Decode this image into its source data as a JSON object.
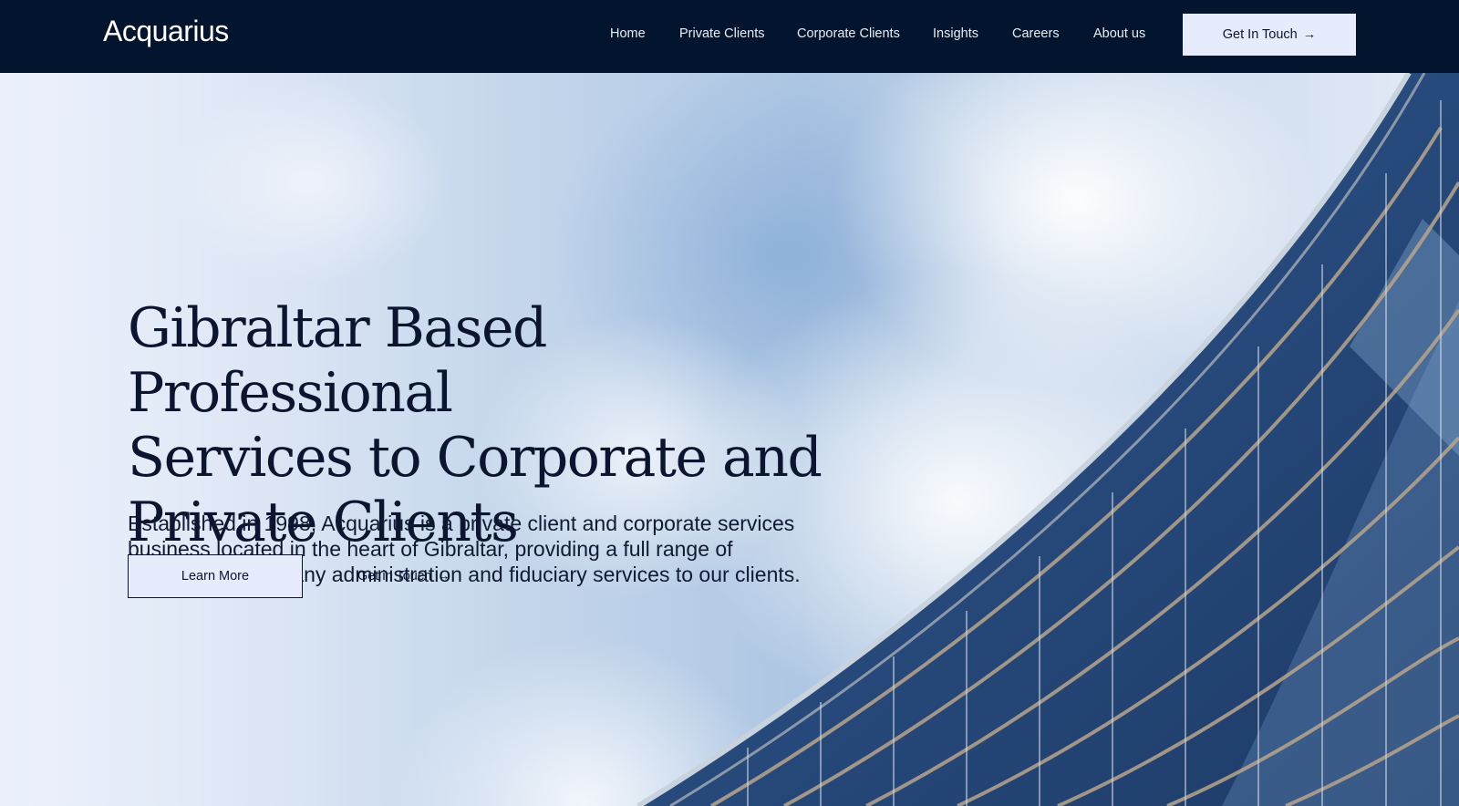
{
  "header": {
    "logo": "Acquarius",
    "nav": [
      {
        "label": "Home"
      },
      {
        "label": "Private Clients"
      },
      {
        "label": "Corporate Clients"
      },
      {
        "label": "Insights"
      },
      {
        "label": "Careers"
      },
      {
        "label": "About us"
      }
    ],
    "cta_label": "Get In Touch",
    "cta_icon": "arrow-right-icon"
  },
  "hero": {
    "title_lines": [
      "Gibraltar Based Professional",
      "Services to Corporate and",
      "Private Clients"
    ],
    "description_lines": [
      "Established in 1998, Acquarius is a private client and corporate services",
      "business located in the heart of Gibraltar, providing a full range of",
      "accounting, company administration and fiduciary services to our clients."
    ],
    "primary_button": "Learn More",
    "secondary_link": "Get in Touch",
    "secondary_icon": "arrow-right-icon",
    "background_image": "curved-glass-office-building-against-cloudy-sky"
  },
  "colors": {
    "header_bg": "#02142e",
    "button_bg": "#e6ecfb",
    "text_dark": "#0b1530"
  }
}
